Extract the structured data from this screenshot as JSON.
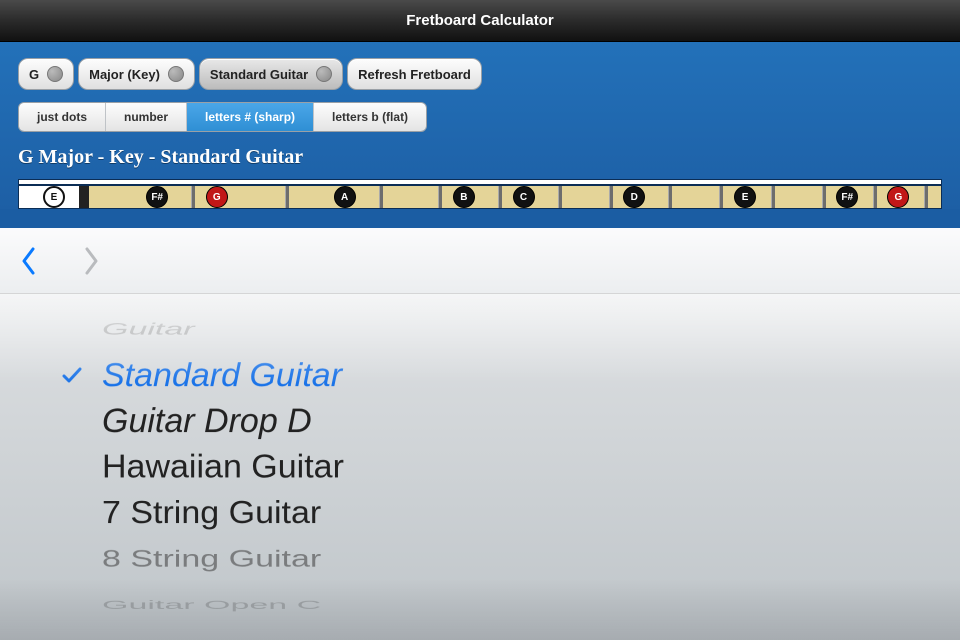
{
  "title": "Fretboard Calculator",
  "toolbar": {
    "note": "G",
    "scale": "Major (Key)",
    "tuning": "Standard Guitar",
    "refresh": "Refresh Fretboard"
  },
  "segments": {
    "just_dots": "just dots",
    "number": "number",
    "sharp": "letters # (sharp)",
    "flat": "letters b (flat)",
    "active_index": 2
  },
  "heading": "G Major - Key - Standard Guitar",
  "fretboard": {
    "open_note": "E",
    "positions": [
      {
        "pct": 8,
        "label": "F#",
        "type": "black"
      },
      {
        "pct": 15,
        "label": "G",
        "type": "red"
      },
      {
        "pct": 30,
        "label": "A",
        "type": "black"
      },
      {
        "pct": 44,
        "label": "B",
        "type": "black"
      },
      {
        "pct": 51,
        "label": "C",
        "type": "black"
      },
      {
        "pct": 64,
        "label": "D",
        "type": "black"
      },
      {
        "pct": 77,
        "label": "E",
        "type": "black"
      },
      {
        "pct": 89,
        "label": "F#",
        "type": "black"
      },
      {
        "pct": 95,
        "label": "G",
        "type": "red"
      }
    ],
    "fret_dividers_pct": [
      12,
      23,
      34,
      41,
      48,
      55,
      61,
      68,
      74,
      80,
      86,
      92,
      98
    ]
  },
  "picker": {
    "items": [
      "Guitar",
      "Standard Guitar",
      "Guitar Drop D",
      "Hawaiian Guitar",
      "7 String Guitar",
      "8 String Guitar",
      "Guitar Open C"
    ],
    "selected_index": 1
  }
}
